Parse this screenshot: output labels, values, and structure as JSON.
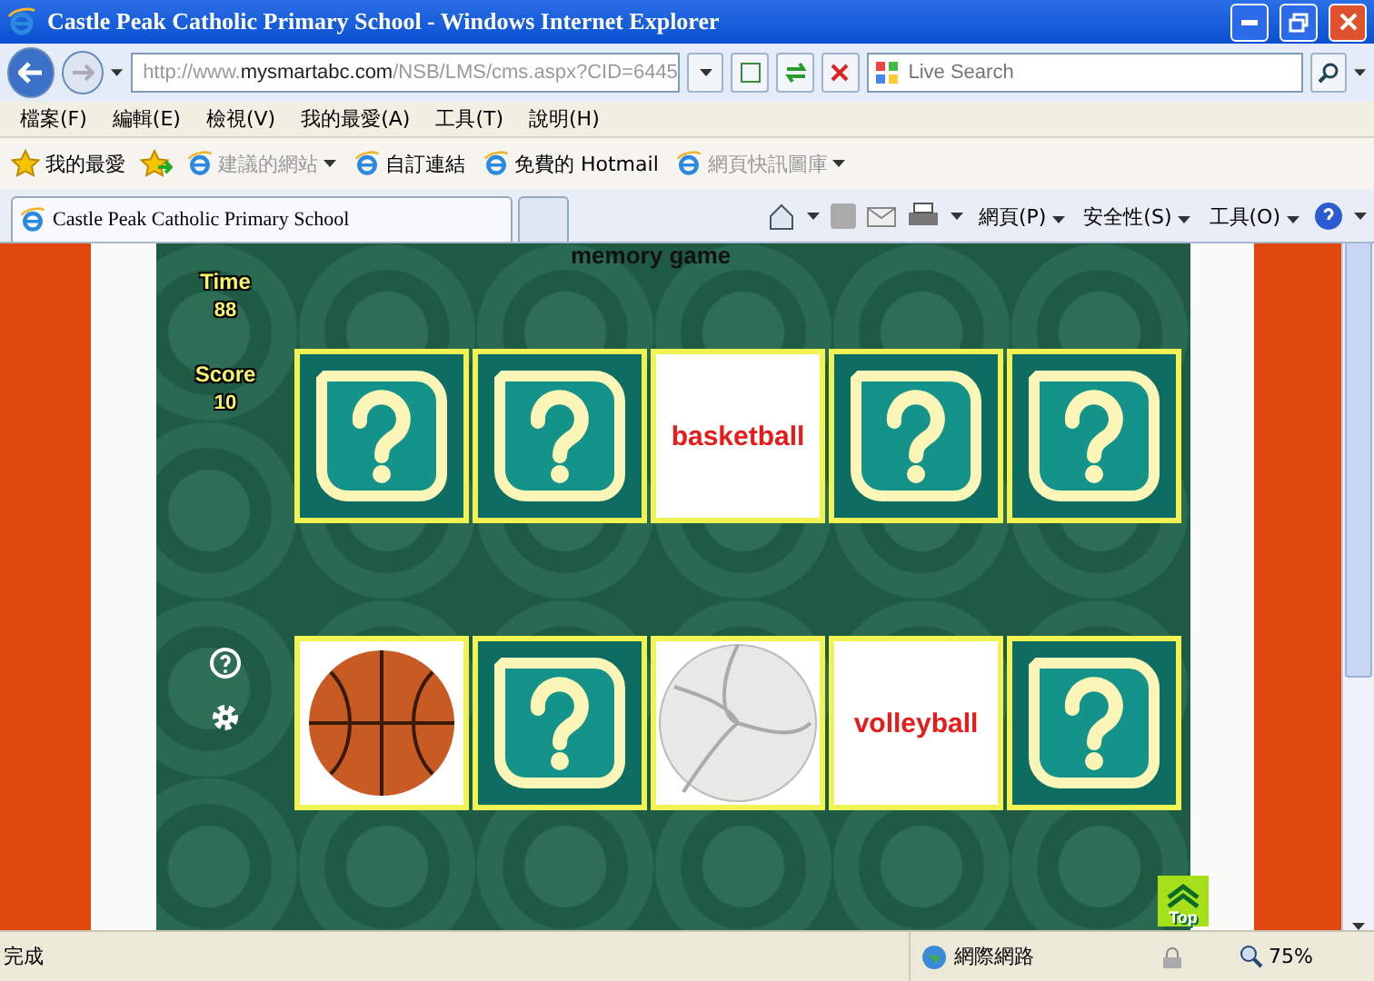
{
  "window": {
    "title": "Castle Peak Catholic Primary School - Windows Internet Explorer"
  },
  "address_bar": {
    "url_prefix": "http://www.",
    "url_domain": "mysmartabc.com",
    "url_path": "/NSB/LMS/cms.aspx?CID=6445"
  },
  "search": {
    "placeholder": "Live Search"
  },
  "menu": [
    "檔案(F)",
    "編輯(E)",
    "檢視(V)",
    "我的最愛(A)",
    "工具(T)",
    "說明(H)"
  ],
  "favorites_bar": {
    "label": "我的最愛",
    "links": [
      {
        "label": "建議的網站",
        "disabled": true,
        "dropdown": true
      },
      {
        "label": "自訂連結",
        "disabled": false,
        "dropdown": false
      },
      {
        "label": "免費的 Hotmail",
        "disabled": false,
        "dropdown": false
      },
      {
        "label": "網頁快訊圖庫",
        "disabled": true,
        "dropdown": true
      }
    ]
  },
  "tabs": [
    {
      "label": "Castle Peak Catholic Primary School",
      "selected": true
    }
  ],
  "command_bar": [
    "網頁(P)",
    "安全性(S)",
    "工具(O)"
  ],
  "game": {
    "heading": "memory game",
    "time_label": "Time",
    "time": "88",
    "score_label": "Score",
    "score": "10",
    "rows": [
      [
        {
          "kind": "hidden"
        },
        {
          "kind": "hidden"
        },
        {
          "kind": "word",
          "text": "basketball"
        },
        {
          "kind": "hidden"
        },
        {
          "kind": "hidden"
        }
      ],
      [
        {
          "kind": "basketball"
        },
        {
          "kind": "hidden"
        },
        {
          "kind": "volleyball"
        },
        {
          "kind": "word",
          "text": "volleyball"
        },
        {
          "kind": "hidden"
        }
      ]
    ],
    "top_button": "Top"
  },
  "status_bar": {
    "status": "完成",
    "zone": "網際網路",
    "zoom": "75%"
  }
}
